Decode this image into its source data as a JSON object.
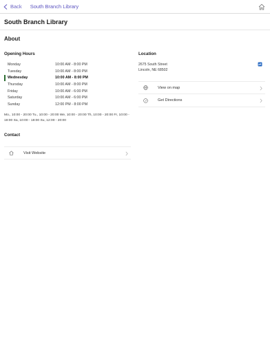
{
  "nav": {
    "back_label": "Back",
    "title": "South Branch Library"
  },
  "page_title": "South Branch Library",
  "about_heading": "About",
  "hours": {
    "heading": "Opening Hours",
    "rows": [
      {
        "day": "Monday",
        "time": "10:00 AM - 8:00 PM"
      },
      {
        "day": "Tuesday",
        "time": "10:00 AM - 8:00 PM"
      },
      {
        "day": "Wednesday",
        "time": "10:00 AM - 8:00 PM"
      },
      {
        "day": "Thursday",
        "time": "10:00 AM - 8:00 PM"
      },
      {
        "day": "Friday",
        "time": "10:00 AM - 6:00 PM"
      },
      {
        "day": "Saturday",
        "time": "10:00 AM - 6:00 PM"
      },
      {
        "day": "Sunday",
        "time": "12:00 PM - 8:00 PM"
      }
    ],
    "today_index": 2,
    "today_marker_color": "#2a6b30",
    "summary": "Mo., 10:00 - 20:00 Tu., 10:00 - 20:00 We, 10:00 - 20:00 Th, 10:00 - 20:00 Fr, 10:00 - 18:00 Sa, 10:00 - 18:00 Su, 12:00 - 20:00"
  },
  "location": {
    "heading": "Location",
    "address_line1": "2675 South Street",
    "address_line2": "Lincoln, NE 68502",
    "directions_icon": "directions-icon",
    "view_on_map": "View on map",
    "get_directions": "Get Directions"
  },
  "contact": {
    "heading": "Contact",
    "visit_website": "Visit Website"
  },
  "colors": {
    "accent": "#5b53c0",
    "icon_blue": "#2f6fc4"
  }
}
